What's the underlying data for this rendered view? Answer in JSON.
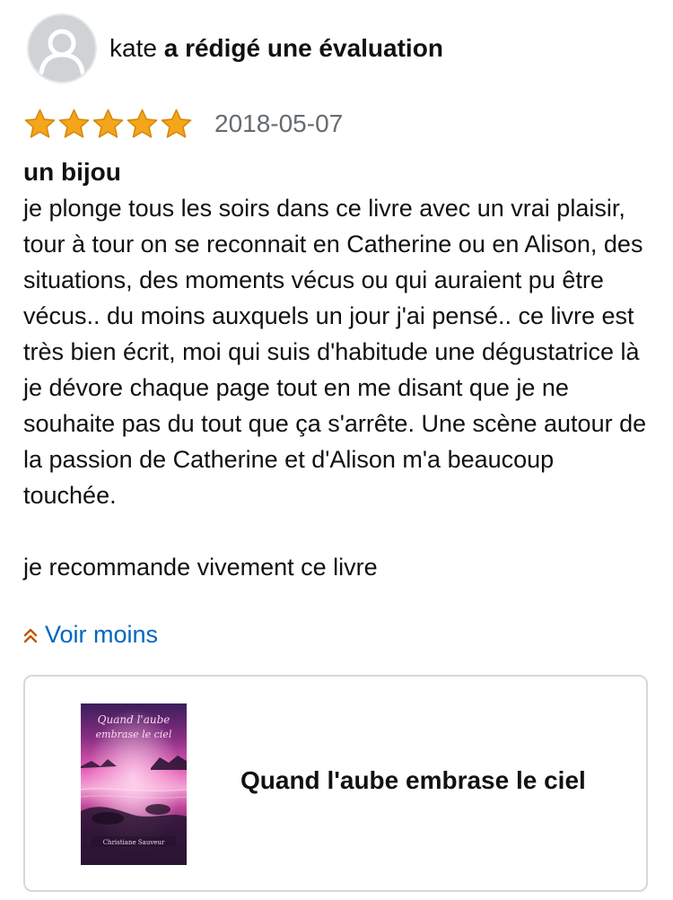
{
  "review": {
    "author": "kate",
    "action": "a rédigé une évaluation",
    "rating": 5,
    "rating_max": 5,
    "date": "2018-05-07",
    "title": "un bijou",
    "body_paragraphs": [
      "je plonge tous les soirs dans ce livre avec un vrai plaisir, tour à tour on se reconnait en Catherine ou en Alison, des situations, des moments vécus ou qui auraient pu être vécus.. du moins auxquels un jour j'ai pensé.. ce livre est très bien écrit, moi qui suis d'habitude une dégustatrice là je dévore chaque page tout en me disant que je ne souhaite pas du tout que ça s'arrête. Une scène autour de la passion de Catherine et d'Alison m'a beaucoup touchée.",
      "je recommande vivement ce livre"
    ],
    "see_less_label": "Voir moins"
  },
  "product": {
    "title": "Quand l'aube embrase le ciel",
    "cover_title_script": "Quand l'aube embrase le ciel",
    "cover_author": "Christiane Sauveur"
  },
  "colors": {
    "star": "#f4a51c",
    "star_outline": "#d48806",
    "link": "#0066c0",
    "date": "#666b70",
    "chevron": "#c45500"
  },
  "icons": {
    "avatar": "default-user-avatar-icon",
    "star": "star-filled-icon",
    "see_less": "chevron-double-up-icon"
  }
}
